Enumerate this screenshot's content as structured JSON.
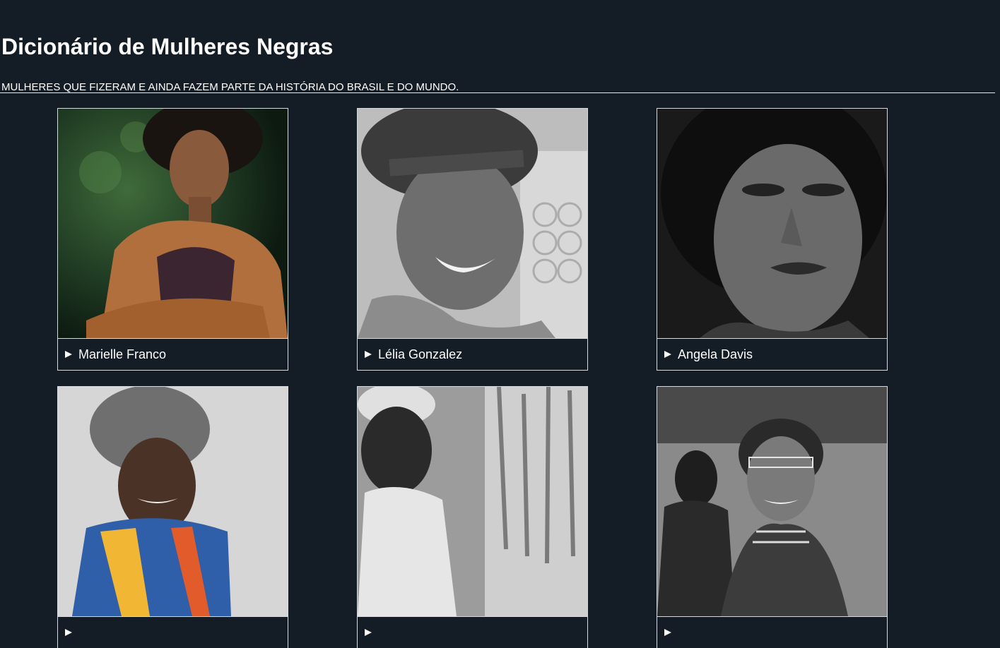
{
  "header": {
    "title": "Dicionário de Mulheres Negras",
    "subtitle": "MULHERES QUE FIZERAM E AINDA FAZEM PARTE DA HISTÓRIA DO BRASIL E DO MUNDO."
  },
  "cards": [
    {
      "name": "Marielle Franco"
    },
    {
      "name": "Lélia Gonzalez"
    },
    {
      "name": "Angela Davis"
    },
    {
      "name": ""
    },
    {
      "name": ""
    },
    {
      "name": ""
    }
  ],
  "colors": {
    "background": "#141c26",
    "text": "#ffffff",
    "border": "#d9d9d9"
  },
  "icons": {
    "expand": "disclosure-triangle-icon"
  }
}
